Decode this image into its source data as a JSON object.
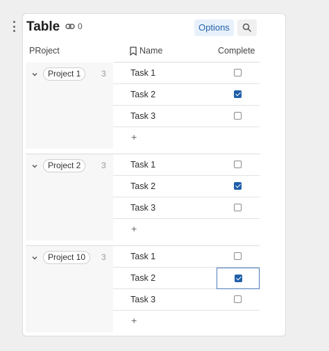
{
  "header": {
    "title": "Table",
    "link_count": "0",
    "options_label": "Options"
  },
  "columns": {
    "project": "PRoject",
    "name": "Name",
    "complete": "Complete"
  },
  "groups": [
    {
      "project": "Project 1",
      "count": "3",
      "tasks": [
        {
          "name": "Task 1",
          "complete": false
        },
        {
          "name": "Task 2",
          "complete": true
        },
        {
          "name": "Task 3",
          "complete": false
        }
      ]
    },
    {
      "project": "Project 2",
      "count": "3",
      "tasks": [
        {
          "name": "Task 1",
          "complete": false
        },
        {
          "name": "Task 2",
          "complete": true
        },
        {
          "name": "Task 3",
          "complete": false
        }
      ]
    },
    {
      "project": "Project 10",
      "count": "3",
      "tasks": [
        {
          "name": "Task 1",
          "complete": false
        },
        {
          "name": "Task 2",
          "complete": true
        },
        {
          "name": "Task 3",
          "complete": false
        }
      ]
    }
  ],
  "add_row_label": "+",
  "icons": {
    "drag": "drag-handle-icon",
    "link": "link-icon",
    "search": "search-icon",
    "bookmark": "bookmark-icon",
    "chevron": "chevron-down-icon"
  },
  "colors": {
    "accent": "#1f5fa8",
    "options_bg": "#e8f1fb"
  }
}
